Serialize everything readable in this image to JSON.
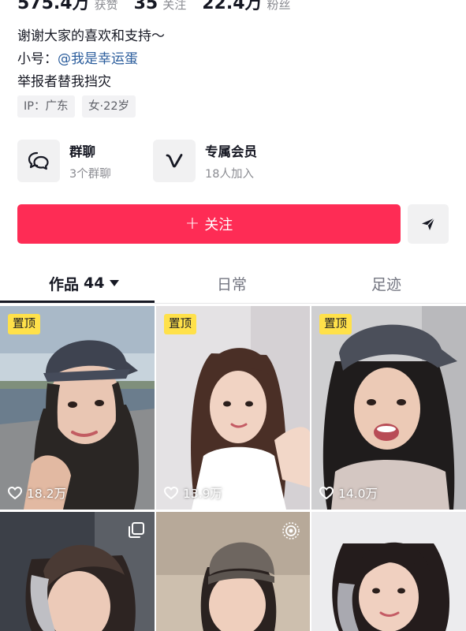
{
  "stats": [
    {
      "value": "575.4万",
      "label": "获赞"
    },
    {
      "value": "35",
      "label": "关注"
    },
    {
      "value": "22.4万",
      "label": "粉丝"
    }
  ],
  "bio": {
    "line1": "谢谢大家的喜欢和支持～",
    "line2_prefix": "小号：",
    "line2_link": "@我是幸运蛋",
    "line3": "举报者替我挡灾"
  },
  "tags": {
    "ip": "IP：广东",
    "gender_age": "女·22岁"
  },
  "features": {
    "group": {
      "title": "群聊",
      "subtitle": "3个群聊",
      "icon": "chat-bubbles-icon"
    },
    "member": {
      "title": "专属会员",
      "subtitle": "18人加入",
      "icon": "v-member-icon"
    }
  },
  "actions": {
    "follow_plus": "+",
    "follow_label": "关注",
    "share_icon": "send-arrow-icon",
    "follow_color": "#fe2c55"
  },
  "tabs": [
    {
      "label": "作品",
      "count": "44",
      "active": true
    },
    {
      "label": "日常",
      "active": false
    },
    {
      "label": "足迹",
      "active": false
    }
  ],
  "videos": [
    {
      "pinned": true,
      "pin_label": "置顶",
      "likes": "18.2万"
    },
    {
      "pinned": true,
      "pin_label": "置顶",
      "likes": "13.9万"
    },
    {
      "pinned": true,
      "pin_label": "置顶",
      "likes": "14.0万"
    },
    {
      "pinned": false,
      "corner_icon": "multi-image-icon"
    },
    {
      "pinned": false,
      "corner_icon": "live-photo-icon"
    },
    {
      "pinned": false
    }
  ]
}
